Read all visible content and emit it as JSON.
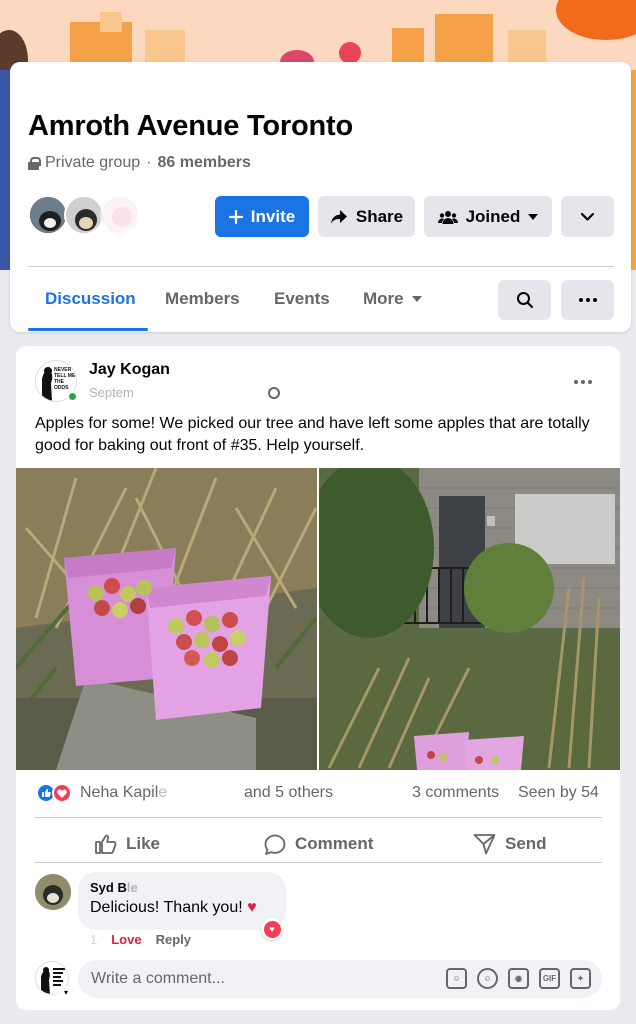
{
  "group": {
    "title": "Amroth Avenue Toronto",
    "privacy": "Private group",
    "separator": "·",
    "members": "86 members"
  },
  "actions": {
    "invite": "Invite",
    "share": "Share",
    "joined": "Joined"
  },
  "tabs": [
    {
      "label": "Discussion",
      "active": true
    },
    {
      "label": "Members"
    },
    {
      "label": "Events"
    },
    {
      "label": "More"
    }
  ],
  "post": {
    "author": "Jay Kogan",
    "time_partial": "Septem",
    "avatar_lettering": "NEVER TELL ME THE ODDS",
    "text": "Apples for some! We picked our tree and have left some apples that are totally good for baking out front of #35. Help yourself.",
    "reactor": "Neha Kapil",
    "reactor_fade": "e",
    "others": "and 5 others",
    "comments": "3 comments",
    "seen": "Seen by 54",
    "like": "Like",
    "comment": "Comment",
    "send": "Send"
  },
  "comment": {
    "author_visible": "Syd B",
    "author_fade": "le",
    "text": "Delicious! Thank you!",
    "time": "1",
    "love_label": "Love",
    "reply_label": "Reply"
  },
  "composer": {
    "placeholder": "Write a comment..."
  },
  "colors": {
    "accent": "#1b74e4",
    "love": "#f33e58",
    "online": "#31a24c"
  }
}
